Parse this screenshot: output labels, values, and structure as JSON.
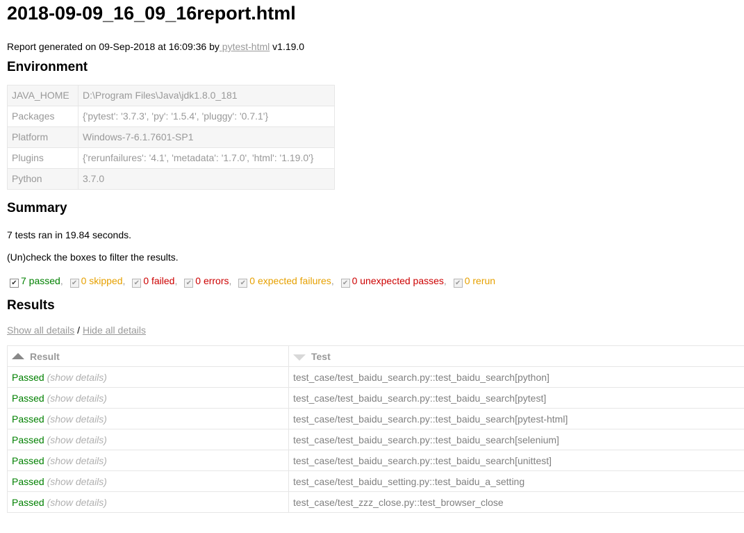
{
  "title": "2018-09-09_16_09_16report.html",
  "generated": {
    "prefix": "Report generated on 09-Sep-2018 at 16:09:36 by",
    "link_text": " pytest-html",
    "suffix": " v1.19.0"
  },
  "environment": {
    "heading": "Environment",
    "rows": [
      {
        "key": "JAVA_HOME",
        "value": "D:\\Program Files\\Java\\jdk1.8.0_181"
      },
      {
        "key": "Packages",
        "value": "{'pytest': '3.7.3', 'py': '1.5.4', 'pluggy': '0.7.1'}"
      },
      {
        "key": "Platform",
        "value": "Windows-7-6.1.7601-SP1"
      },
      {
        "key": "Plugins",
        "value": "{'rerunfailures': '4.1', 'metadata': '1.7.0', 'html': '1.19.0'}"
      },
      {
        "key": "Python",
        "value": "3.7.0"
      }
    ]
  },
  "summary": {
    "heading": "Summary",
    "ran": "7 tests ran in 19.84 seconds.",
    "filter_hint": "(Un)check the boxes to filter the results.",
    "filters": [
      {
        "label": "7 passed",
        "color": "#008000",
        "checked": true,
        "enabled": true,
        "sep": ","
      },
      {
        "label": "0 skipped",
        "color": "#e6a000",
        "checked": true,
        "enabled": false,
        "sep": ","
      },
      {
        "label": "0 failed",
        "color": "#cc0000",
        "checked": true,
        "enabled": false,
        "sep": ","
      },
      {
        "label": "0 errors",
        "color": "#cc0000",
        "checked": true,
        "enabled": false,
        "sep": ","
      },
      {
        "label": "0 expected failures",
        "color": "#e6a000",
        "checked": true,
        "enabled": false,
        "sep": ","
      },
      {
        "label": "0 unexpected passes",
        "color": "#cc0000",
        "checked": true,
        "enabled": false,
        "sep": ","
      },
      {
        "label": "0 rerun",
        "color": "#e6a000",
        "checked": true,
        "enabled": false,
        "sep": ""
      }
    ]
  },
  "results": {
    "heading": "Results",
    "show_all": "Show all details",
    "slash": " / ",
    "hide_all": "Hide all details",
    "columns": {
      "result": "Result",
      "test": "Test"
    },
    "rows": [
      {
        "result": "Passed",
        "details": "(show details)",
        "test": "test_case/test_baidu_search.py::test_baidu_search[python]"
      },
      {
        "result": "Passed",
        "details": "(show details)",
        "test": "test_case/test_baidu_search.py::test_baidu_search[pytest]"
      },
      {
        "result": "Passed",
        "details": "(show details)",
        "test": "test_case/test_baidu_search.py::test_baidu_search[pytest-html]"
      },
      {
        "result": "Passed",
        "details": "(show details)",
        "test": "test_case/test_baidu_search.py::test_baidu_search[selenium]"
      },
      {
        "result": "Passed",
        "details": "(show details)",
        "test": "test_case/test_baidu_search.py::test_baidu_search[unittest]"
      },
      {
        "result": "Passed",
        "details": "(show details)",
        "test": "test_case/test_baidu_setting.py::test_baidu_a_setting"
      },
      {
        "result": "Passed",
        "details": "(show details)",
        "test": "test_case/test_zzz_close.py::test_browser_close"
      }
    ]
  }
}
